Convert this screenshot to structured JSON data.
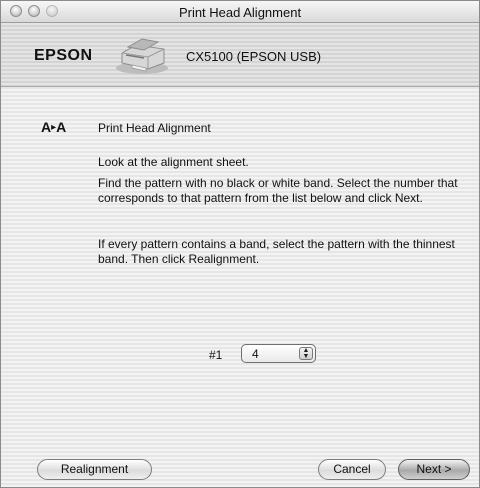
{
  "window": {
    "title": "Print Head Alignment"
  },
  "header": {
    "brand": "EPSON",
    "model": "CX5100 (EPSON USB)",
    "icon": "printer-icon"
  },
  "section": {
    "icon_text": "A▸A",
    "title": "Print Head Alignment"
  },
  "instructions": [
    "Look at the alignment sheet.",
    "Find the pattern with no black or white band. Select the number that corresponds to that pattern from the list below and click Next.",
    "If every pattern contains a band, select the pattern with the thinnest band. Then click Realignment."
  ],
  "pattern_select": {
    "label": "#1",
    "value": "4"
  },
  "buttons": {
    "realignment": "Realignment",
    "cancel": "Cancel",
    "next": "Next >"
  }
}
